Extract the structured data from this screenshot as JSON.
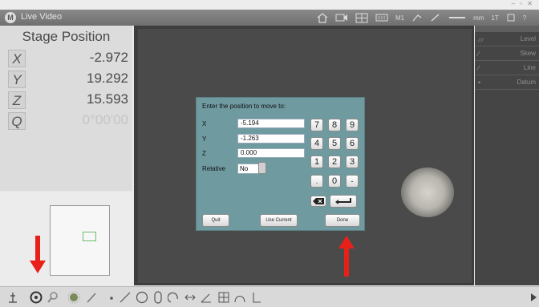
{
  "window": {
    "title": "Live Video",
    "app_icon_letter": "M"
  },
  "toolbar": {
    "magnification": "M1",
    "units": "mm",
    "mode": "1T",
    "help": "?"
  },
  "stage": {
    "title": "Stage Position",
    "axes": [
      {
        "label": "X",
        "value": "-2.972"
      },
      {
        "label": "Y",
        "value": "19.292"
      },
      {
        "label": "Z",
        "value": "15.593"
      },
      {
        "label": "Q",
        "value": "0°00'00"
      }
    ]
  },
  "right_panel": {
    "items": [
      {
        "label": "Level"
      },
      {
        "label": "Skew"
      },
      {
        "label": "Line"
      },
      {
        "label": "Datum"
      }
    ]
  },
  "dialog": {
    "title": "Enter the position to move to:",
    "fields": [
      {
        "label": "X",
        "value": "-5.194"
      },
      {
        "label": "Y",
        "value": "-1.263"
      },
      {
        "label": "Z",
        "value": "0.000"
      }
    ],
    "relative": {
      "label": "Relative",
      "value": "No"
    },
    "keys": [
      "7",
      "8",
      "9",
      "4",
      "5",
      "6",
      "1",
      "2",
      "3",
      ".",
      "0",
      "-"
    ],
    "buttons": {
      "quit": "Quit",
      "use_current": "Use Current",
      "done": "Done"
    }
  },
  "colors": {
    "dialog_bg": "#6f9aa0",
    "arrow": "#e8201a",
    "preview_roi": "#6bbd6b"
  }
}
